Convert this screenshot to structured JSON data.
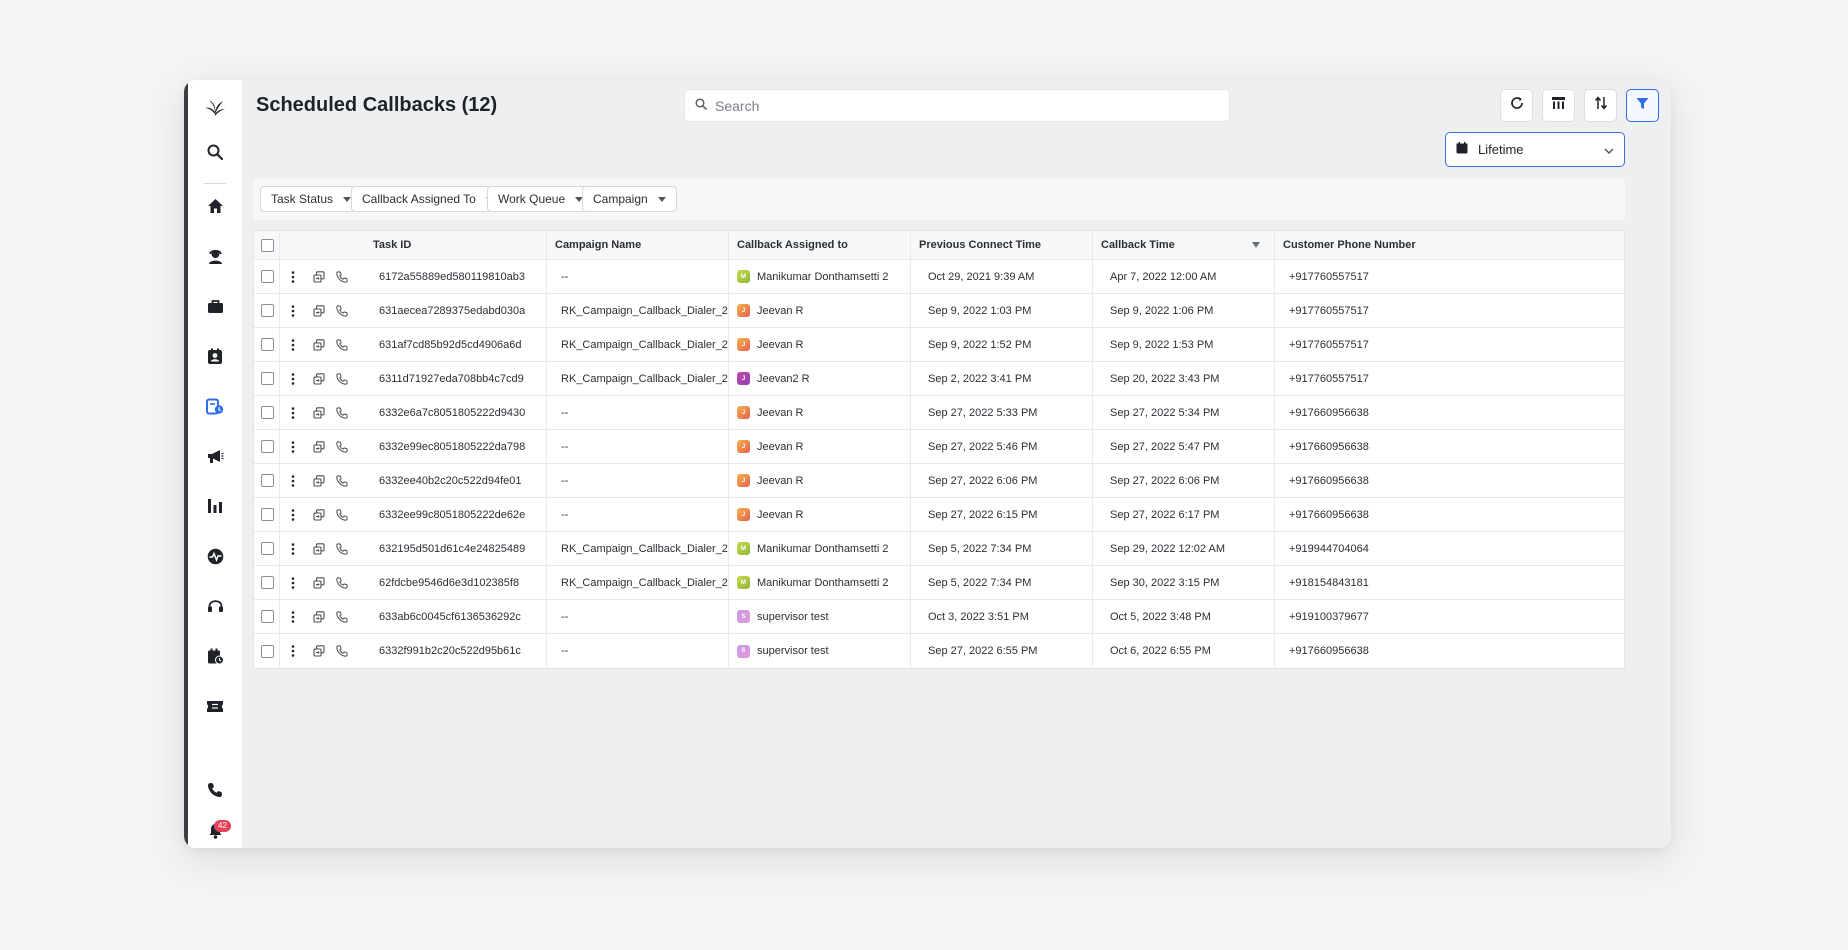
{
  "page": {
    "title": "Scheduled Callbacks (12)"
  },
  "search": {
    "placeholder": "Search"
  },
  "toolbar": {
    "buttons": [
      "refresh-icon",
      "columns-icon",
      "sort-icon",
      "filter-icon"
    ]
  },
  "date_range": {
    "value": "Lifetime"
  },
  "filters": [
    {
      "label": "Task Status"
    },
    {
      "label": "Callback Assigned To"
    },
    {
      "label": "Work Queue"
    },
    {
      "label": "Campaign"
    }
  ],
  "table": {
    "columns": [
      "Task ID",
      "Campaign Name",
      "Callback Assigned to",
      "Previous Connect Time",
      "Callback Time",
      "Customer Phone Number"
    ],
    "rows": [
      {
        "task_id": "6172a55889ed580119810ab3",
        "campaign": "--",
        "avatar": "M",
        "assignee": "Manikumar Donthamsetti 2",
        "prev": "Oct 29, 2021 9:39 AM",
        "callback": "Apr 7, 2022 12:00 AM",
        "phone": "+917760557517"
      },
      {
        "task_id": "631aecea7289375edabd030a",
        "campaign": "RK_Campaign_Callback_Dialer_2",
        "avatar": "J",
        "assignee": "Jeevan R",
        "prev": "Sep 9, 2022 1:03 PM",
        "callback": "Sep 9, 2022 1:06 PM",
        "phone": "+917760557517"
      },
      {
        "task_id": "631af7cd85b92d5cd4906a6d",
        "campaign": "RK_Campaign_Callback_Dialer_2",
        "avatar": "J",
        "assignee": "Jeevan R",
        "prev": "Sep 9, 2022 1:52 PM",
        "callback": "Sep 9, 2022 1:53 PM",
        "phone": "+917760557517"
      },
      {
        "task_id": "6311d71927eda708bb4c7cd9",
        "campaign": "RK_Campaign_Callback_Dialer_2",
        "avatar": "J",
        "assignee": "Jeevan2 R",
        "prev": "Sep 2, 2022 3:41 PM",
        "callback": "Sep 20, 2022 3:43 PM",
        "phone": "+917760557517"
      },
      {
        "task_id": "6332e6a7c8051805222d9430",
        "campaign": "--",
        "avatar": "J",
        "assignee": "Jeevan R",
        "prev": "Sep 27, 2022 5:33 PM",
        "callback": "Sep 27, 2022 5:34 PM",
        "phone": "+917660956638"
      },
      {
        "task_id": "6332e99ec8051805222da798",
        "campaign": "--",
        "avatar": "J",
        "assignee": "Jeevan R",
        "prev": "Sep 27, 2022 5:46 PM",
        "callback": "Sep 27, 2022 5:47 PM",
        "phone": "+917660956638"
      },
      {
        "task_id": "6332ee40b2c20c522d94fe01",
        "campaign": "--",
        "avatar": "J",
        "assignee": "Jeevan R",
        "prev": "Sep 27, 2022 6:06 PM",
        "callback": "Sep 27, 2022 6:06 PM",
        "phone": "+917660956638"
      },
      {
        "task_id": "6332ee99c8051805222de62e",
        "campaign": "--",
        "avatar": "J",
        "assignee": "Jeevan R",
        "prev": "Sep 27, 2022 6:15 PM",
        "callback": "Sep 27, 2022 6:17 PM",
        "phone": "+917660956638"
      },
      {
        "task_id": "632195d501d61c4e24825489",
        "campaign": "RK_Campaign_Callback_Dialer_2",
        "avatar": "M",
        "assignee": "Manikumar Donthamsetti 2",
        "prev": "Sep 5, 2022 7:34 PM",
        "callback": "Sep 29, 2022 12:02 AM",
        "phone": "+919944704064"
      },
      {
        "task_id": "62fdcbe9546d6e3d102385f8",
        "campaign": "RK_Campaign_Callback_Dialer_2",
        "avatar": "M",
        "assignee": "Manikumar Donthamsetti 2",
        "prev": "Sep 5, 2022 7:34 PM",
        "callback": "Sep 30, 2022 3:15 PM",
        "phone": "+918154843181"
      },
      {
        "task_id": "633ab6c0045cf6136536292c",
        "campaign": "--",
        "avatar": "S",
        "assignee": "supervisor test",
        "prev": "Oct 3, 2022 3:51 PM",
        "callback": "Oct 5, 2022 3:48 PM",
        "phone": "+919100379677"
      },
      {
        "task_id": "6332f991b2c20c522d95b61c",
        "campaign": "--",
        "avatar": "S",
        "assignee": "supervisor test",
        "prev": "Sep 27, 2022 6:55 PM",
        "callback": "Oct 6, 2022 6:55 PM",
        "phone": "+917660956638"
      }
    ]
  },
  "avatar_colors": {
    "M": [
      "#c6d84a",
      "#8fb83a"
    ],
    "J": [
      "#f2b24d",
      "#e8604f"
    ],
    "J2": [
      "#c64aa0",
      "#8d3fb8"
    ],
    "S": [
      "#c79be8",
      "#e69ad6"
    ]
  },
  "notifications": {
    "count": "42"
  },
  "sidebar": {
    "items": [
      "logo-icon",
      "search-icon",
      "home-icon",
      "agent-icon",
      "briefcase-icon",
      "contacts-icon",
      "callbacks-icon",
      "campaign-icon",
      "reports-icon",
      "activity-icon",
      "headset-icon",
      "calendar-icon",
      "ticket-icon",
      "phone-icon",
      "bell-icon"
    ],
    "active": "callbacks-icon",
    "active_color": "#2f6fed"
  }
}
